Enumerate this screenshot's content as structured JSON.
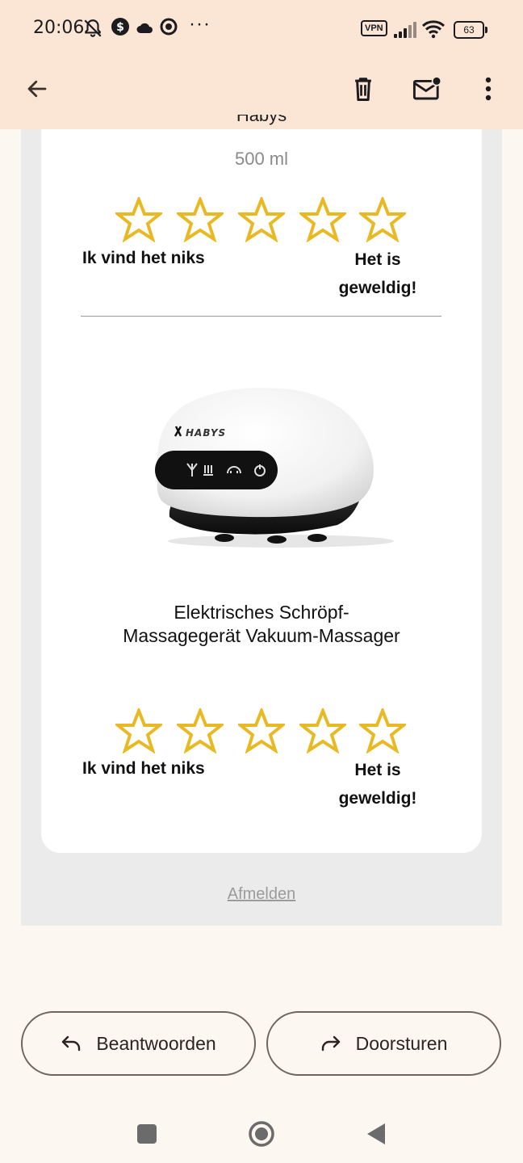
{
  "status_bar": {
    "time": "20:06",
    "vpn_label": "VPN",
    "battery": "63",
    "more_dots": "···"
  },
  "toolbar": {
    "back_icon": "arrow-left-icon",
    "delete_icon": "trash-icon",
    "mark_unread_icon": "mail-unread-icon",
    "more_icon": "more-vert-icon"
  },
  "email": {
    "product1": {
      "title_clipped": "Habys",
      "volume": "500 ml",
      "rating_low_label": "Ik vind het niks",
      "rating_high_label": "Het is geweldig!",
      "star_count": 5
    },
    "product2": {
      "title": "Elektrisches Schröpf-Massagegerät Vakuum-Massager",
      "rating_low_label": "Ik vind het niks",
      "rating_high_label": "Het is geweldig!",
      "star_count": 5
    },
    "unsubscribe": "Afmelden"
  },
  "actions": {
    "reply_label": "Beantwoorden",
    "forward_label": "Doorsturen"
  },
  "colors": {
    "header_bg": "#fbe6d6",
    "star": "#e9b923"
  }
}
